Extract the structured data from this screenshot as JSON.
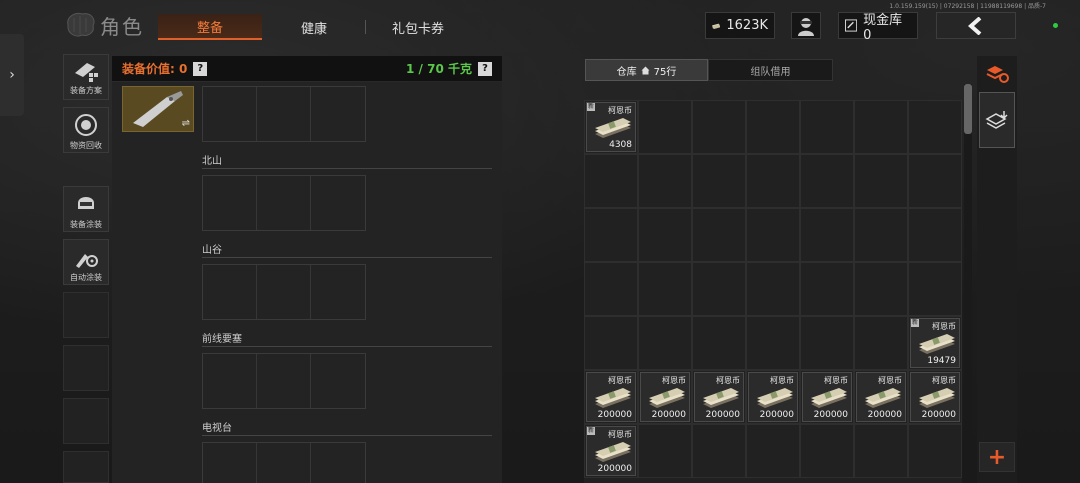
{
  "header": {
    "title": "角色",
    "version": "1.0.159.159(15) | 07292158 | 11988119698 | 品质-7",
    "tabs": [
      {
        "label": "整备",
        "active": true
      },
      {
        "label": "健康",
        "active": false
      },
      {
        "label": "礼包卡券",
        "active": false
      }
    ],
    "currency_value": "1623K",
    "vault_label": "现金库 0"
  },
  "sidebar": {
    "tools": [
      {
        "label": "装备方案",
        "icon": "loadout-icon"
      },
      {
        "label": "物资回收",
        "icon": "recycle-icon"
      },
      {
        "label": "装备涂装",
        "icon": "skin-icon"
      },
      {
        "label": "自动涂装",
        "icon": "auto-paint-icon"
      }
    ]
  },
  "equipment": {
    "value_label": "装备价值: 0",
    "help": "?",
    "weight": "1 / 70 千克",
    "swap_symbol": "⇌",
    "maps": [
      "北山",
      "山谷",
      "前线要塞",
      "电视台"
    ]
  },
  "warehouse": {
    "tab_active": "仓库",
    "tab_active_count": "75行",
    "tab_inactive": "组队借用",
    "items": [
      {
        "name": "柯恩币",
        "qty": "4308",
        "new": true,
        "row": 0,
        "col": 0
      },
      {
        "name": "柯恩币",
        "qty": "19479",
        "new": true,
        "row": 4,
        "col": 6
      },
      {
        "name": "柯恩币",
        "qty": "200000",
        "new": false,
        "row": 5,
        "col": 0
      },
      {
        "name": "柯恩币",
        "qty": "200000",
        "new": false,
        "row": 5,
        "col": 1
      },
      {
        "name": "柯恩币",
        "qty": "200000",
        "new": false,
        "row": 5,
        "col": 2
      },
      {
        "name": "柯恩币",
        "qty": "200000",
        "new": false,
        "row": 5,
        "col": 3
      },
      {
        "name": "柯恩币",
        "qty": "200000",
        "new": false,
        "row": 5,
        "col": 4
      },
      {
        "name": "柯恩币",
        "qty": "200000",
        "new": false,
        "row": 5,
        "col": 5
      },
      {
        "name": "柯恩币",
        "qty": "200000",
        "new": false,
        "row": 5,
        "col": 6
      },
      {
        "name": "柯恩币",
        "qty": "200000",
        "new": true,
        "row": 6,
        "col": 0
      }
    ],
    "new_badge": "新",
    "add": "+"
  },
  "colors": {
    "accent": "#e8702e",
    "weight_green": "#5cc84a",
    "online": "#2ecc40"
  }
}
